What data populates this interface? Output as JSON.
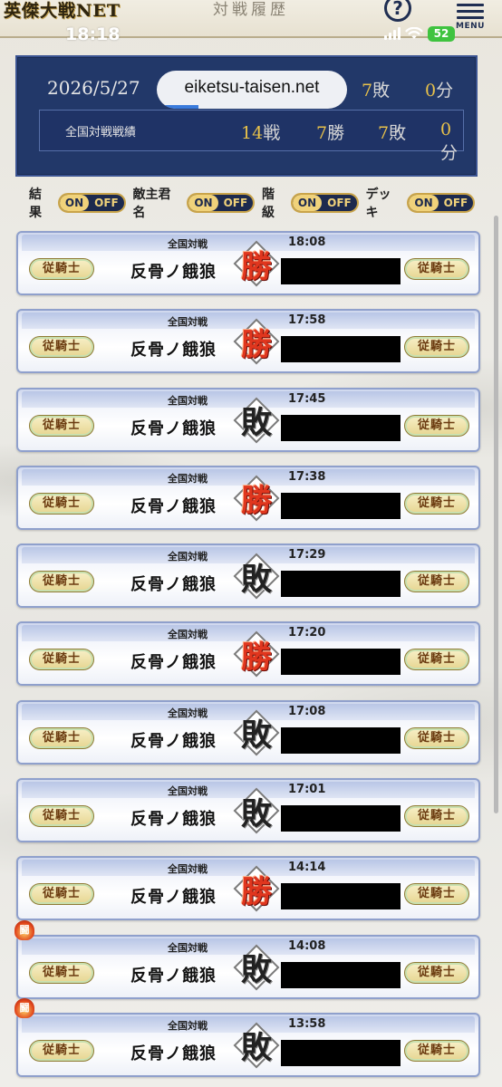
{
  "header": {
    "logo_text": "英傑大戦NET",
    "page_title": "対戦履歴",
    "status_time": "18:18",
    "battery": "52",
    "help_icon_glyph": "?",
    "menu_label": "MENU"
  },
  "browser": {
    "url": "eiketsu-taisen.net",
    "load_progress_pct": 22
  },
  "summary": {
    "date": "2026/5/27",
    "daily_loss_num": "7",
    "daily_loss_unit": "敗",
    "daily_draw_num": "0",
    "daily_draw_unit": "分",
    "national_label": "全国対戦戦績",
    "total_num": "14",
    "total_unit": "戦",
    "win_num": "7",
    "win_unit": "勝",
    "loss_num": "7",
    "loss_unit": "敗",
    "draw_num": "0",
    "draw_unit": "分"
  },
  "filters": [
    {
      "label": "結果",
      "on": "ON",
      "off": "OFF"
    },
    {
      "label": "敵主君名",
      "on": "ON",
      "off": "OFF"
    },
    {
      "label": "階級",
      "on": "ON",
      "off": "OFF"
    },
    {
      "label": "デッキ",
      "on": "ON",
      "off": "OFF"
    }
  ],
  "matches": [
    {
      "type": "全国対戦",
      "time": "18:08",
      "name": "反骨ノ餓狼",
      "result": "勝",
      "outcome": "win",
      "rank": "従騎士",
      "opp_rank": "従騎士",
      "flame": ""
    },
    {
      "type": "全国対戦",
      "time": "17:58",
      "name": "反骨ノ餓狼",
      "result": "勝",
      "outcome": "win",
      "rank": "従騎士",
      "opp_rank": "従騎士",
      "flame": ""
    },
    {
      "type": "全国対戦",
      "time": "17:45",
      "name": "反骨ノ餓狼",
      "result": "敗",
      "outcome": "loss",
      "rank": "従騎士",
      "opp_rank": "従騎士",
      "flame": ""
    },
    {
      "type": "全国対戦",
      "time": "17:38",
      "name": "反骨ノ餓狼",
      "result": "勝",
      "outcome": "win",
      "rank": "従騎士",
      "opp_rank": "従騎士",
      "flame": ""
    },
    {
      "type": "全国対戦",
      "time": "17:29",
      "name": "反骨ノ餓狼",
      "result": "敗",
      "outcome": "loss",
      "rank": "従騎士",
      "opp_rank": "従騎士",
      "flame": ""
    },
    {
      "type": "全国対戦",
      "time": "17:20",
      "name": "反骨ノ餓狼",
      "result": "勝",
      "outcome": "win",
      "rank": "従騎士",
      "opp_rank": "従騎士",
      "flame": ""
    },
    {
      "type": "全国対戦",
      "time": "17:08",
      "name": "反骨ノ餓狼",
      "result": "敗",
      "outcome": "loss",
      "rank": "従騎士",
      "opp_rank": "従騎士",
      "flame": ""
    },
    {
      "type": "全国対戦",
      "time": "17:01",
      "name": "反骨ノ餓狼",
      "result": "敗",
      "outcome": "loss",
      "rank": "従騎士",
      "opp_rank": "従騎士",
      "flame": ""
    },
    {
      "type": "全国対戦",
      "time": "14:14",
      "name": "反骨ノ餓狼",
      "result": "勝",
      "outcome": "win",
      "rank": "従騎士",
      "opp_rank": "従騎士",
      "flame": ""
    },
    {
      "type": "全国対戦",
      "time": "14:08",
      "name": "反骨ノ餓狼",
      "result": "敗",
      "outcome": "loss",
      "rank": "従騎士",
      "opp_rank": "従騎士",
      "flame": "闘"
    },
    {
      "type": "全国対戦",
      "time": "13:58",
      "name": "反骨ノ餓狼",
      "result": "敗",
      "outcome": "loss",
      "rank": "従騎士",
      "opp_rank": "従騎士",
      "flame": "闘"
    }
  ]
}
